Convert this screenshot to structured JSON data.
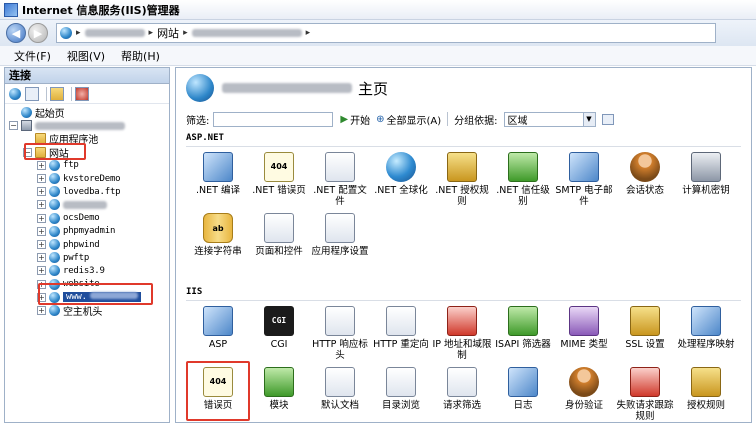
{
  "window": {
    "title": "Internet 信息服务(IIS)管理器"
  },
  "address": {
    "crumb_sites": "网站",
    "arrow": "▸",
    "dropdown_arrow": "▾"
  },
  "menu": {
    "items": [
      "文件(F)",
      "视图(V)",
      "帮助(H)"
    ]
  },
  "connections": {
    "header": "连接",
    "tree": [
      {
        "label": "起始页",
        "indent": 0,
        "expander": "",
        "icon": "start-page-icon"
      },
      {
        "label": "",
        "indent": 0,
        "expander": "⊟",
        "icon": "server-icon",
        "redacted": true
      },
      {
        "label": "应用程序池",
        "indent": 1,
        "expander": "",
        "icon": "app-pool-icon"
      },
      {
        "label": "网站",
        "indent": 1,
        "expander": "⊟",
        "icon": "sites-folder-icon"
      },
      {
        "label": "ftp",
        "indent": 2,
        "expander": "⊞",
        "icon": "site-globe-icon"
      },
      {
        "label": "kvstoreDemo",
        "indent": 2,
        "expander": "⊞",
        "icon": "site-globe-icon"
      },
      {
        "label": "lovedba.ftp",
        "indent": 2,
        "expander": "⊞",
        "icon": "site-globe-icon"
      },
      {
        "label": "",
        "indent": 2,
        "expander": "⊞",
        "icon": "site-globe-icon",
        "redacted": true
      },
      {
        "label": "ocsDemo",
        "indent": 2,
        "expander": "⊞",
        "icon": "site-globe-icon"
      },
      {
        "label": "phpmyadmin",
        "indent": 2,
        "expander": "⊞",
        "icon": "site-globe-icon"
      },
      {
        "label": "phpwind",
        "indent": 2,
        "expander": "⊞",
        "icon": "site-globe-icon"
      },
      {
        "label": "pwftp",
        "indent": 2,
        "expander": "⊞",
        "icon": "site-globe-icon"
      },
      {
        "label": "redis3.9",
        "indent": 2,
        "expander": "⊞",
        "icon": "site-globe-icon"
      },
      {
        "label": "website",
        "indent": 2,
        "expander": "⊞",
        "icon": "site-globe-icon"
      },
      {
        "label": "www.",
        "indent": 2,
        "expander": "⊞",
        "icon": "site-globe-icon",
        "selected": true
      },
      {
        "label": "空主机头",
        "indent": 2,
        "expander": "⊞",
        "icon": "site-globe-icon"
      }
    ]
  },
  "main": {
    "title_suffix": "主页",
    "filter": {
      "label": "筛选:",
      "start_label": "开始",
      "show_all_label": "全部显示(A)",
      "group_label": "分组依据:",
      "group_value": "区域"
    },
    "sections": [
      {
        "title": "ASP.NET",
        "features": [
          {
            "label": ".NET 编译",
            "icon": "net-compile-icon",
            "cls": "i-blue"
          },
          {
            "label": ".NET 错误页",
            "icon": "net-error-pages-icon",
            "cls": "i-404",
            "glyph": "404"
          },
          {
            "label": ".NET 配置文件",
            "icon": "net-profile-icon",
            "cls": "i-doc"
          },
          {
            "label": ".NET 全球化",
            "icon": "net-globalization-icon",
            "cls": "i-globe"
          },
          {
            "label": ".NET 授权规则",
            "icon": "net-authorization-icon",
            "cls": "i-lock"
          },
          {
            "label": ".NET 信任级别",
            "icon": "net-trust-icon",
            "cls": "i-green"
          },
          {
            "label": "SMTP 电子邮件",
            "icon": "smtp-email-icon",
            "cls": "i-blue"
          },
          {
            "label": "会话状态",
            "icon": "session-state-icon",
            "cls": "i-person"
          },
          {
            "label": "计算机密钥",
            "icon": "machine-key-icon",
            "cls": "i-gray"
          },
          {
            "label": "连接字符串",
            "icon": "connection-strings-icon",
            "cls": "i-db",
            "glyph": "ab"
          },
          {
            "label": "页面和控件",
            "icon": "pages-controls-icon",
            "cls": "i-doc"
          },
          {
            "label": "应用程序设置",
            "icon": "app-settings-icon",
            "cls": "i-doc"
          }
        ]
      },
      {
        "title": "IIS",
        "features": [
          {
            "label": "ASP",
            "icon": "asp-icon",
            "cls": "i-blue"
          },
          {
            "label": "CGI",
            "icon": "cgi-icon",
            "cls": "i-cgi",
            "glyph": "CGI"
          },
          {
            "label": "HTTP 响应标头",
            "icon": "http-headers-icon",
            "cls": "i-doc"
          },
          {
            "label": "HTTP 重定向",
            "icon": "http-redirect-icon",
            "cls": "i-doc"
          },
          {
            "label": "IP 地址和域限制",
            "icon": "ip-restrictions-icon",
            "cls": "i-red"
          },
          {
            "label": "ISAPI 筛选器",
            "icon": "isapi-filters-icon",
            "cls": "i-green"
          },
          {
            "label": "MIME 类型",
            "icon": "mime-types-icon",
            "cls": "i-purple"
          },
          {
            "label": "SSL 设置",
            "icon": "ssl-settings-icon",
            "cls": "i-lock"
          },
          {
            "label": "处理程序映射",
            "icon": "handler-mappings-icon",
            "cls": "i-blue"
          },
          {
            "label": "错误页",
            "icon": "error-pages-icon",
            "cls": "i-404",
            "glyph": "404"
          },
          {
            "label": "模块",
            "icon": "modules-icon",
            "cls": "i-green"
          },
          {
            "label": "默认文档",
            "icon": "default-document-icon",
            "cls": "i-doc"
          },
          {
            "label": "目录浏览",
            "icon": "directory-browsing-icon",
            "cls": "i-doc"
          },
          {
            "label": "请求筛选",
            "icon": "request-filtering-icon",
            "cls": "i-doc"
          },
          {
            "label": "日志",
            "icon": "logging-icon",
            "cls": "i-blue"
          },
          {
            "label": "身份验证",
            "icon": "authentication-icon",
            "cls": "i-person"
          },
          {
            "label": "失败请求跟踪规则",
            "icon": "failed-request-tracing-icon",
            "cls": "i-red"
          },
          {
            "label": "授权规则",
            "icon": "authorization-rules-icon",
            "cls": "i-lock"
          }
        ]
      }
    ]
  }
}
